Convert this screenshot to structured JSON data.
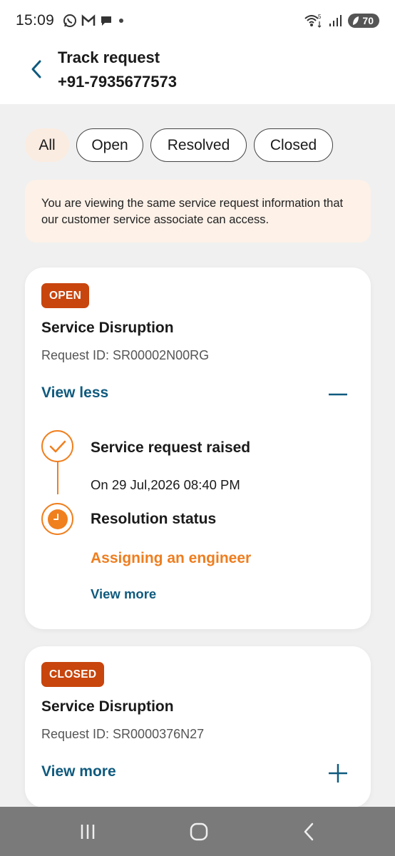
{
  "status_bar": {
    "time": "15:09",
    "battery": "70",
    "icons_left": [
      "whatsapp-icon",
      "gmail-icon",
      "chat-icon",
      "dot-icon"
    ],
    "icons_right": [
      "wifi-icon",
      "signal-icon",
      "battery-icon"
    ]
  },
  "header": {
    "title": "Track request",
    "subtitle": "+91-7935677573"
  },
  "filters": [
    {
      "label": "All",
      "active": true
    },
    {
      "label": "Open",
      "active": false
    },
    {
      "label": "Resolved",
      "active": false
    },
    {
      "label": "Closed",
      "active": false
    }
  ],
  "notice": "You are viewing the same service request information that our customer service associate can access.",
  "requests": [
    {
      "badge": "OPEN",
      "title": "Service Disruption",
      "request_id": "Request ID: SR00002N00RG",
      "toggle_label": "View less",
      "timeline": {
        "step1_title": "Service request raised",
        "step1_date": "On 29 Jul,2026 08:40 PM",
        "step2_title": "Resolution status",
        "step2_status": "Assigning an engineer",
        "view_more": "View more"
      }
    },
    {
      "badge": "CLOSED",
      "title": "Service Disruption",
      "request_id": "Request ID: SR0000376N27",
      "toggle_label": "View more"
    }
  ],
  "colors": {
    "accent_orange": "#f07f1e",
    "badge": "#c8450d",
    "link_blue": "#0f5a7e",
    "chip_active_bg": "#fbece1"
  }
}
